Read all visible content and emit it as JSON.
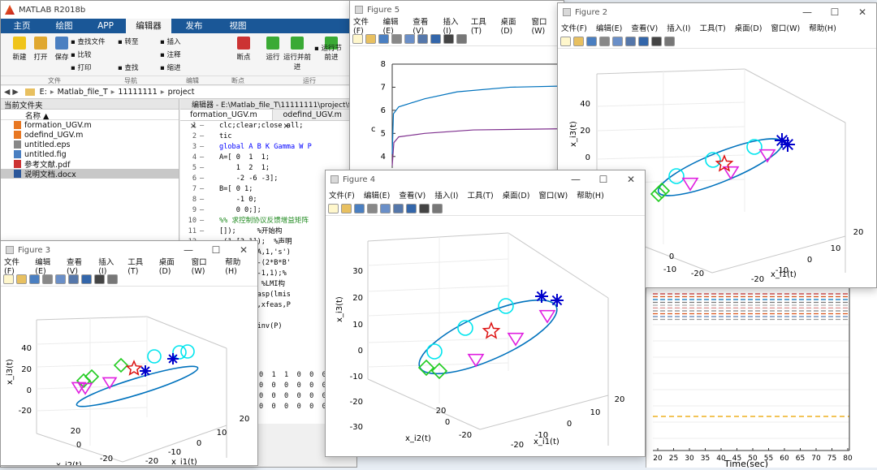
{
  "matlab": {
    "title": "MATLAB R2018b",
    "ribbon_tabs": [
      "主页",
      "绘图",
      "APP",
      "编辑器",
      "发布",
      "视图"
    ],
    "ribbon_buttons": [
      {
        "label": "新建",
        "color": "#f0c419"
      },
      {
        "label": "打开",
        "color": "#e0a830"
      },
      {
        "label": "保存",
        "color": "#4a7fc1"
      },
      {
        "label": "断点",
        "color": "#cc3333"
      },
      {
        "label": "运行",
        "color": "#3aaa35"
      },
      {
        "label": "运行并前进",
        "color": "#3aaa35"
      },
      {
        "label": "前进",
        "color": "#3aaa35"
      }
    ],
    "ribbon_small": [
      "查找文件",
      "比较",
      "打印",
      "转至",
      "查找",
      "插入",
      "注释",
      "缩进",
      "运行节"
    ],
    "ribbon_groups": [
      "文件",
      "导航",
      "编辑",
      "断点",
      "运行"
    ],
    "path": [
      "E:",
      "Matlab_file_T",
      "11111111",
      "project"
    ],
    "current_folder": {
      "header": "当前文件夹",
      "column": "名称",
      "files": [
        {
          "name": "formation_UGV.m",
          "icon": "m-file-icon",
          "color": "#e87722",
          "selected": false
        },
        {
          "name": "odefind_UGV.m",
          "icon": "m-file-icon",
          "color": "#e87722",
          "selected": false
        },
        {
          "name": "untitled.eps",
          "icon": "file-icon",
          "color": "#888888",
          "selected": false
        },
        {
          "name": "untitled.fig",
          "icon": "fig-file-icon",
          "color": "#4a7fc1",
          "selected": false
        },
        {
          "name": "参考文献.pdf",
          "icon": "pdf-file-icon",
          "color": "#cc3333",
          "selected": false
        },
        {
          "name": "说明文档.docx",
          "icon": "docx-file-icon",
          "color": "#2b579a",
          "selected": true
        }
      ]
    },
    "editor": {
      "title": "编辑器 - E:\\Matlab_file_T\\11111111\\project\\form",
      "tabs": [
        "formation_UGV.m",
        "odefind_UGV.m"
      ],
      "lines": [
        {
          "num": "1",
          "code": "clc;clear;close all;",
          "color": "#000000"
        },
        {
          "num": "2",
          "code": "tic",
          "color": "#000000"
        },
        {
          "num": "3",
          "code": "global A B K Gamma W P",
          "color": "#0000ff"
        },
        {
          "num": "4",
          "code": "A=[ 0  1  1;",
          "color": "#000000"
        },
        {
          "num": "5",
          "code": "    1  2  1;",
          "color": "#000000"
        },
        {
          "num": "6",
          "code": "    -2 -6 -3];",
          "color": "#000000"
        },
        {
          "num": "7",
          "code": "B=[ 0 1;",
          "color": "#000000"
        },
        {
          "num": "8",
          "code": "    -1 0;",
          "color": "#000000"
        },
        {
          "num": "9",
          "code": "    0 0;];",
          "color": "#000000"
        },
        {
          "num": "10",
          "code": "%% 求控制协议反馈增益矩阵",
          "color": "#228b22"
        },
        {
          "num": "11",
          "code": "[]);     %开始构",
          "color": "#000000"
        },
        {
          "num": "12",
          "code": "-(1,[3,1]);  %声明",
          "color": "#000000"
        },
        {
          "num": "13",
          "code": "1 1 1 P],A,1,'s')",
          "color": "#000000"
        },
        {
          "num": "14",
          "code": "1 1 1 0],-(2*B*B'",
          "color": "#000000"
        },
        {
          "num": "15",
          "code": "2 1 1 P],-1,1);%",
          "color": "#000000"
        },
        {
          "num": "16",
          "code": "getlmis;  %LMI构",
          "color": "#000000"
        },
        {
          "num": "17",
          "code": "eas] = feasp(lmis",
          "color": "#000000"
        },
        {
          "num": "18",
          "code": "at(lmisys,xfeas,P",
          "color": "#000000"
        },
        {
          "num": "19",
          "code": "(P)",
          "color": "#000000"
        },
        {
          "num": "20",
          "code": "(P)*B*B'*inv(P)",
          "color": "#000000"
        }
      ],
      "matrix_rows": [
        "0  1  1  0  0  0",
        "0  0  0  0  0  0",
        "0  0  0  0  0  0",
        "0  0  0  0  0  0"
      ]
    }
  },
  "figure5": {
    "title": "Figure 5",
    "menu": [
      "文件(F)",
      "编辑(E)",
      "查看(V)",
      "插入(I)",
      "工具(T)",
      "桌面(D)",
      "窗口(W)"
    ],
    "ylabel": "c",
    "chart_data": {
      "type": "line",
      "yticks": [
        4,
        5,
        6,
        7,
        8
      ],
      "series": [
        {
          "color": "#0072bd",
          "points": [
            [
              0,
              4.1
            ],
            [
              1.5,
              5.85
            ],
            [
              8,
              6.15
            ],
            [
              40,
              6.5
            ],
            [
              80,
              6.8
            ],
            [
              145,
              7.0
            ],
            [
              210,
              7.05
            ]
          ]
        },
        {
          "color": "#7e2f8e",
          "points": [
            [
              0,
              3.6
            ],
            [
              2,
              4.6
            ],
            [
              8,
              4.85
            ],
            [
              40,
              5.0
            ],
            [
              100,
              5.15
            ],
            [
              210,
              5.2
            ]
          ]
        }
      ]
    }
  },
  "figure2": {
    "title": "Figure 2",
    "menu": [
      "文件(F)",
      "编辑(E)",
      "查看(V)",
      "插入(I)",
      "工具(T)",
      "桌面(D)",
      "窗口(W)",
      "帮助(H)"
    ],
    "chart_data": {
      "type": "scatter",
      "zlabel": "x_i3(t)",
      "xlabel": "x_i1(t)",
      "zticks": [
        "40",
        "20",
        "0",
        "-20"
      ],
      "xticks": [
        "20",
        "10",
        "0",
        "-10",
        "-20"
      ],
      "yticks": [
        "0",
        "-10",
        "-20"
      ]
    }
  },
  "figure4": {
    "title": "Figure 4",
    "menu": [
      "文件(F)",
      "编辑(E)",
      "查看(V)",
      "插入(I)",
      "工具(T)",
      "桌面(D)",
      "窗口(W)",
      "帮助(H)"
    ],
    "chart_data": {
      "type": "scatter",
      "zlabel": "x_i3(t)",
      "xlabel": "x_i1(t)",
      "ylabel": "x_i2(t)",
      "zticks": [
        "30",
        "20",
        "10",
        "0",
        "-10",
        "-20",
        "-30"
      ],
      "xticks": [
        "20",
        "10",
        "0",
        "-10",
        "-20"
      ],
      "yticks": [
        "20",
        "0",
        "-20"
      ]
    }
  },
  "figure3": {
    "title": "Figure 3",
    "menu": [
      "文件(F)",
      "编辑(E)",
      "查看(V)",
      "插入(I)",
      "工具(T)",
      "桌面(D)",
      "窗口(W)",
      "帮助(H)"
    ],
    "chart_data": {
      "type": "scatter",
      "zlabel": "x_i3(t)",
      "xlabel": "x_i1(t)",
      "ylabel": "x_i2(t)",
      "zticks": [
        "40",
        "20",
        "0",
        "-20"
      ],
      "xticks": [
        "20",
        "10",
        "0",
        "-10",
        "-20"
      ],
      "yticks": [
        "20",
        "0",
        "-20"
      ]
    }
  },
  "figure_bottom": {
    "chart_data": {
      "type": "line",
      "xlabel": "Time(sec)",
      "xticks": [
        "20",
        "25",
        "30",
        "35",
        "40",
        "45",
        "50",
        "55",
        "60",
        "65",
        "70",
        "75",
        "80"
      ]
    }
  }
}
